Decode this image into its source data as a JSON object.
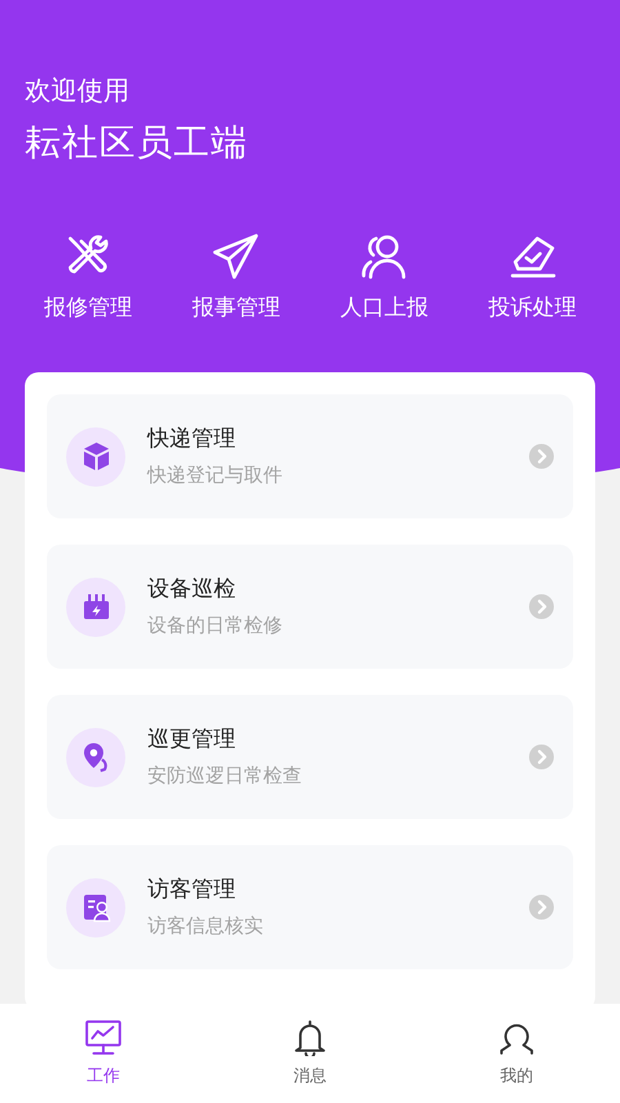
{
  "header": {
    "greeting": "欢迎使用",
    "title": "耘社区员工端"
  },
  "shortcuts": [
    {
      "label": "报修管理"
    },
    {
      "label": "报事管理"
    },
    {
      "label": "人口上报"
    },
    {
      "label": "投诉处理"
    }
  ],
  "services": [
    {
      "title": "快递管理",
      "subtitle": "快递登记与取件"
    },
    {
      "title": "设备巡检",
      "subtitle": "设备的日常检修"
    },
    {
      "title": "巡更管理",
      "subtitle": "安防巡逻日常检查"
    },
    {
      "title": "访客管理",
      "subtitle": "访客信息核实"
    }
  ],
  "tabs": [
    {
      "label": "工作",
      "selected": true
    },
    {
      "label": "消息",
      "selected": false
    },
    {
      "label": "我的",
      "selected": false
    }
  ]
}
